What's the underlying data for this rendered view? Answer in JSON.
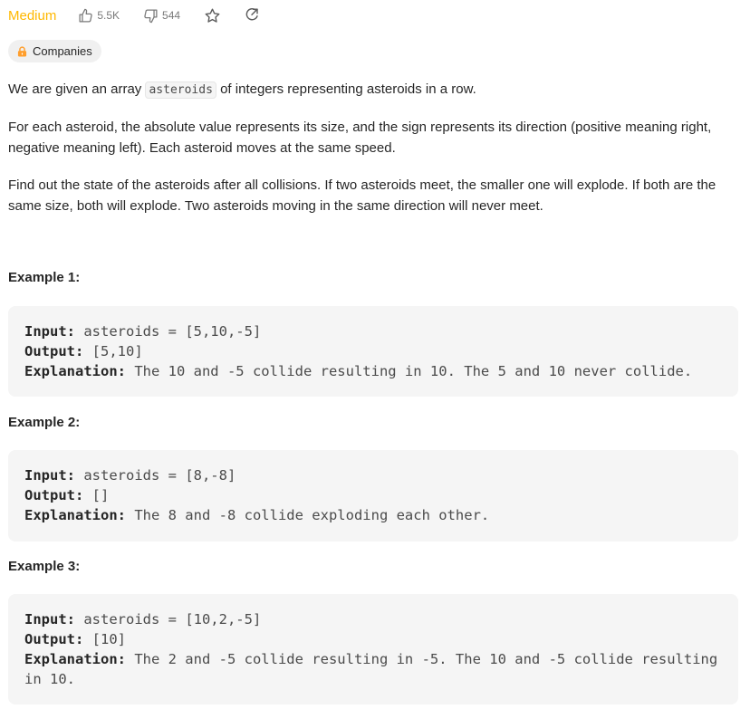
{
  "header": {
    "difficulty": "Medium",
    "likes": "5.5K",
    "dislikes": "544",
    "icons": [
      "thumbs-up-icon",
      "thumbs-down-icon",
      "star-icon",
      "share-icon"
    ]
  },
  "companies": {
    "label": "Companies",
    "icon": "lock-icon",
    "lock_color": "#ff9e2c"
  },
  "description": {
    "p1_before": "We are given an array ",
    "p1_code": "asteroids",
    "p1_after": " of integers representing asteroids in a row.",
    "p2": "For each asteroid, the absolute value represents its size, and the sign represents its direction (positive meaning right, negative meaning left). Each asteroid moves at the same speed.",
    "p3": "Find out the state of the asteroids after all collisions. If two asteroids meet, the smaller one will explode. If both are the same size, both will explode. Two asteroids moving in the same direction will never meet."
  },
  "examples": [
    {
      "title": "Example 1:",
      "input_label": "Input:",
      "input": " asteroids = [5,10,-5]",
      "output_label": "Output:",
      "output": " [5,10]",
      "explanation_label": "Explanation:",
      "explanation": " The 10 and -5 collide resulting in 10. The 5 and 10 never collide."
    },
    {
      "title": "Example 2:",
      "input_label": "Input:",
      "input": " asteroids = [8,-8]",
      "output_label": "Output:",
      "output": " []",
      "explanation_label": "Explanation:",
      "explanation": " The 8 and -8 collide exploding each other."
    },
    {
      "title": "Example 3:",
      "input_label": "Input:",
      "input": " asteroids = [10,2,-5]",
      "output_label": "Output:",
      "output": " [10]",
      "explanation_label": "Explanation:",
      "explanation": " The 2 and -5 collide resulting in -5. The 10 and -5 collide resulting in 10."
    }
  ],
  "colors": {
    "difficulty_medium": "#ffb800",
    "code_background": "#f5f5f5",
    "muted_text": "#7a7a7a"
  }
}
